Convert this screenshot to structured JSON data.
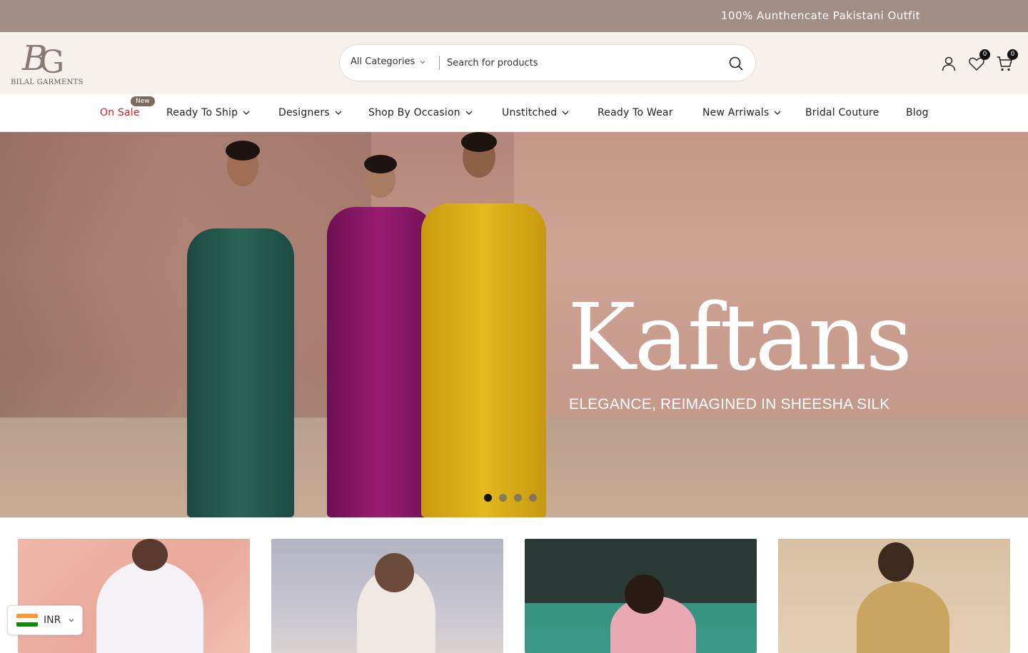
{
  "announcement": {
    "text": "100% Aunthencate Pakistani Outfit"
  },
  "header": {
    "logo_monogram": "BG",
    "logo_name": "BILAL GARMENTS",
    "search": {
      "category_label": "All Categories",
      "placeholder": "Search for products",
      "value": ""
    },
    "wishlist_count": "0",
    "cart_count": "0"
  },
  "nav": {
    "items": [
      {
        "label": "On Sale",
        "has_dropdown": false,
        "badge": "New"
      },
      {
        "label": "Ready To Ship",
        "has_dropdown": true
      },
      {
        "label": "Designers",
        "has_dropdown": true
      },
      {
        "label": "Shop By Occasion",
        "has_dropdown": true
      },
      {
        "label": "Unstitched",
        "has_dropdown": true
      },
      {
        "label": "Ready To Wear",
        "has_dropdown": false
      },
      {
        "label": "New Arriwals",
        "has_dropdown": true
      },
      {
        "label": "Bridal Couture",
        "has_dropdown": false
      },
      {
        "label": "Blog",
        "has_dropdown": false
      }
    ]
  },
  "hero": {
    "title": "Kaftans",
    "subtitle": "ELEGANCE, REIMAGINED IN SHEESHA SILK",
    "slide_count": 4,
    "active_slide": 1
  },
  "currency": {
    "code": "INR",
    "flag": "india-flag-icon"
  },
  "colors": {
    "announcement_bg": "#a18e87",
    "header_bg": "#f6f1ed",
    "sale_red": "#d42020",
    "badge_bg": "#7a6a64"
  }
}
